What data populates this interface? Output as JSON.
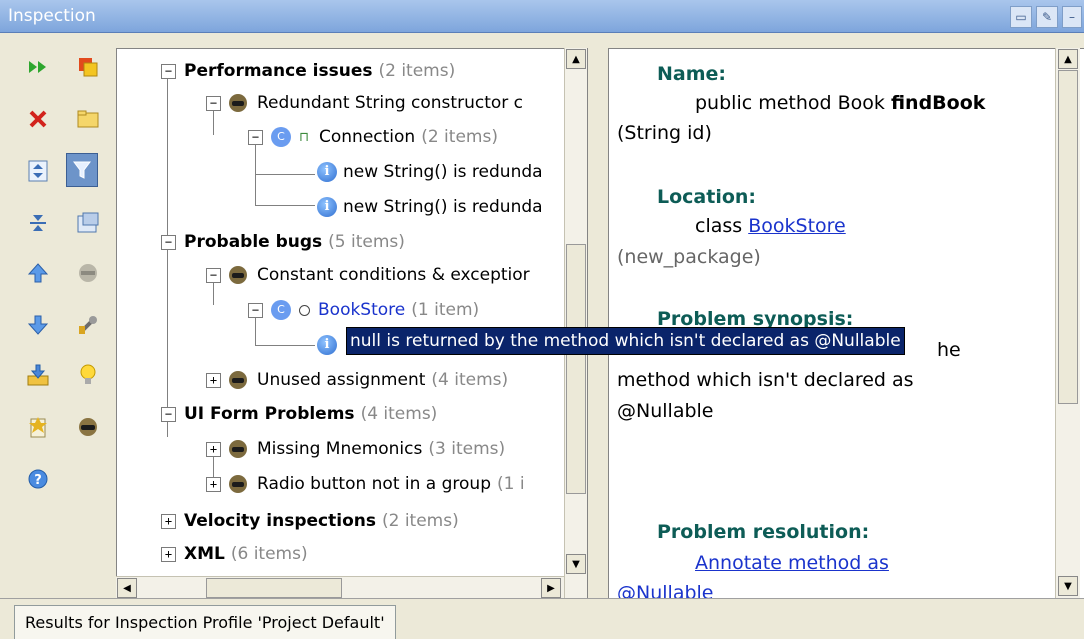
{
  "window": {
    "title": "Inspection"
  },
  "toolbar_icons": [
    "run-icon",
    "export-icon",
    "close-icon",
    "open-folder-icon",
    "expand-all-icon",
    "filter-icon",
    "collapse-all-icon",
    "autoscroll-icon",
    "previous-icon",
    "group-icon",
    "next-icon",
    "settings-wrench-icon",
    "export-down-icon",
    "quickfix-bulb-icon",
    "edit-settings-icon",
    "inspection-icon",
    "help-icon"
  ],
  "tree": [
    {
      "label": "Performance issues",
      "count": "(2 items)"
    },
    {
      "label": "Redundant String constructor c"
    },
    {
      "label": "Connection",
      "count": "(2 items)"
    },
    {
      "label": "new String() is redunda"
    },
    {
      "label": "new String() is redunda"
    },
    {
      "label": "Probable bugs",
      "count": "(5 items)"
    },
    {
      "label": "Constant conditions & exceptior"
    },
    {
      "label": "BookStore",
      "count": "(1 item)"
    },
    {
      "label": "Unused assignment",
      "count": "(4 items)"
    },
    {
      "label": "UI Form Problems",
      "count": "(4 items)"
    },
    {
      "label": "Missing Mnemonics",
      "count": "(3 items)"
    },
    {
      "label": "Radio button not in a group",
      "count": "(1 i"
    },
    {
      "label": "Velocity inspections",
      "count": "(2 items)"
    },
    {
      "label": "XML",
      "count": "(6 items)"
    }
  ],
  "tooltip": "null is returned by the method which isn't declared as @Nullable",
  "detail": {
    "name_heading": "Name:",
    "name_pre": "public method Book ",
    "name_bold": "findBook",
    "name_post": "(String id)",
    "location_heading": "Location:",
    "location_pre": "class ",
    "location_link": "BookStore",
    "location_post": "(new_package)",
    "synopsis_heading": "Problem synopsis:",
    "synopsis_frag": "he",
    "synopsis_line2": "method which isn't declared as",
    "synopsis_line3": "@Nullable",
    "resolution_heading": "Problem resolution:",
    "resolution_link1": "Annotate method as",
    "resolution_link2": "@Nullable"
  },
  "status": {
    "tab": "Results for Inspection Profile 'Project Default'"
  }
}
